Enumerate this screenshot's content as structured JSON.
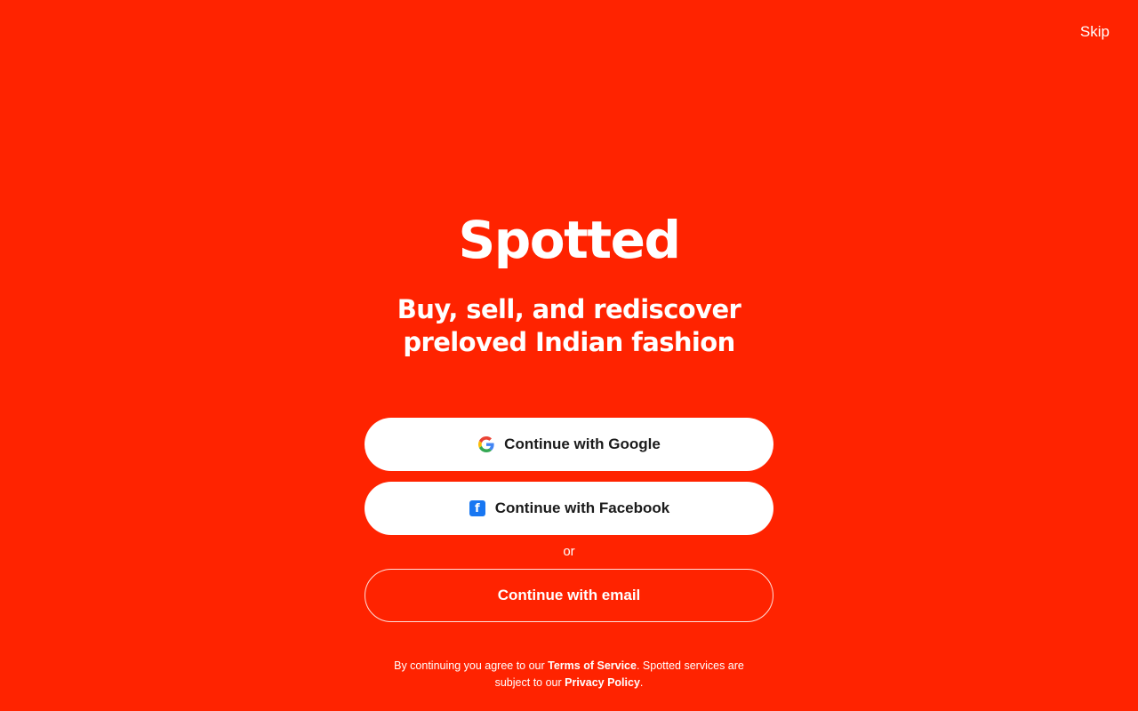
{
  "header": {
    "skip_label": "Skip"
  },
  "hero": {
    "brand": "Spotted",
    "tagline": "Buy, sell, and rediscover preloved Indian fashion"
  },
  "auth": {
    "google_label": "Continue with Google",
    "facebook_label": "Continue with Facebook",
    "divider_label": "or",
    "email_label": "Continue with email"
  },
  "legal": {
    "text_1": "By continuing you agree to our ",
    "terms_label": "Terms of Service",
    "text_2": ". Spotted services are subject to our ",
    "privacy_label": "Privacy Policy",
    "text_3": "."
  },
  "icons": {
    "google": "google-logo-icon",
    "facebook": "facebook-logo-icon"
  },
  "colors": {
    "background": "#FF2300",
    "facebook_blue": "#1877F2",
    "button_text": "#1b1b1b"
  }
}
